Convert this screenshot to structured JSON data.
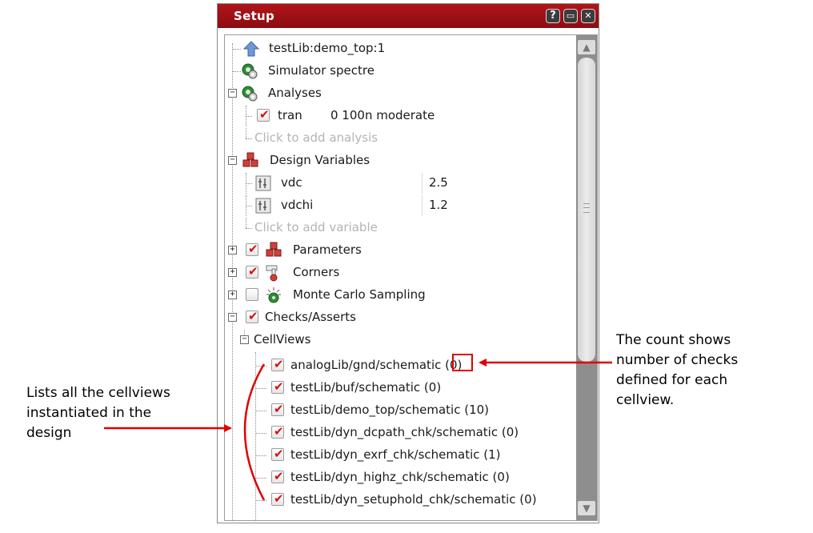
{
  "window": {
    "title": "Setup",
    "buttons": {
      "help": "?",
      "float": "▭",
      "close": "✕"
    }
  },
  "tree": {
    "design": "testLib:demo_top:1",
    "simulator": "Simulator  spectre",
    "analyses": {
      "label": "Analyses",
      "items": [
        {
          "name": "tran",
          "value": "0 100n moderate",
          "checked": true
        }
      ],
      "add_hint": "Click to add analysis"
    },
    "design_variables": {
      "label": "Design Variables",
      "items": [
        {
          "name": "vdc",
          "value": "2.5"
        },
        {
          "name": "vdchi",
          "value": "1.2"
        }
      ],
      "add_hint": "Click to add variable"
    },
    "parameters": {
      "label": "Parameters",
      "checked": true
    },
    "corners": {
      "label": "Corners",
      "checked": true
    },
    "monte_carlo": {
      "label": "Monte Carlo Sampling",
      "checked": false
    },
    "checks_asserts": {
      "label": "Checks/Asserts",
      "checked": true,
      "cellviews": {
        "label": "CellViews",
        "items": [
          "analogLib/gnd/schematic (0)",
          "testLib/buf/schematic (0)",
          "testLib/demo_top/schematic (10)",
          "testLib/dyn_dcpath_chk/schematic (0)",
          "testLib/dyn_exrf_chk/schematic (1)",
          "testLib/dyn_highz_chk/schematic (0)",
          "testLib/dyn_setuphold_chk/schematic (0)"
        ]
      }
    }
  },
  "annotations": {
    "count_note": [
      "The count shows",
      "number of checks",
      "defined for each",
      "cellview."
    ],
    "cellviews_note": [
      "Lists all the cellviews",
      "instantiated in the",
      "design"
    ]
  },
  "colors": {
    "titlebar": "#a51217",
    "check": "#d41111",
    "annotation": "#e20000"
  }
}
